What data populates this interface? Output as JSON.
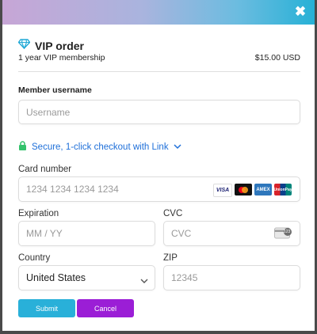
{
  "header": {
    "close_glyph": "✖"
  },
  "order": {
    "title": "VIP order",
    "description": "1 year VIP membership",
    "price": "$15.00 USD"
  },
  "member": {
    "label": "Member username",
    "placeholder": "Username"
  },
  "link": {
    "text": "Secure, 1-click checkout with Link"
  },
  "card": {
    "label": "Card number",
    "placeholder": "1234 1234 1234 1234",
    "brands": [
      "VISA",
      "mastercard",
      "AMEX",
      "UnionPay"
    ]
  },
  "expiration": {
    "label": "Expiration",
    "placeholder": "MM / YY"
  },
  "cvc": {
    "label": "CVC",
    "placeholder": "CVC",
    "badge": "123"
  },
  "country": {
    "label": "Country",
    "value": "United States"
  },
  "zip": {
    "label": "ZIP",
    "placeholder": "12345"
  },
  "buttons": {
    "submit": "Submit",
    "cancel": "Cancel"
  },
  "colors": {
    "submit": "#29b0d9",
    "cancel": "#9b1ed6",
    "link": "#1e6fd9",
    "lock": "#33c26b"
  }
}
